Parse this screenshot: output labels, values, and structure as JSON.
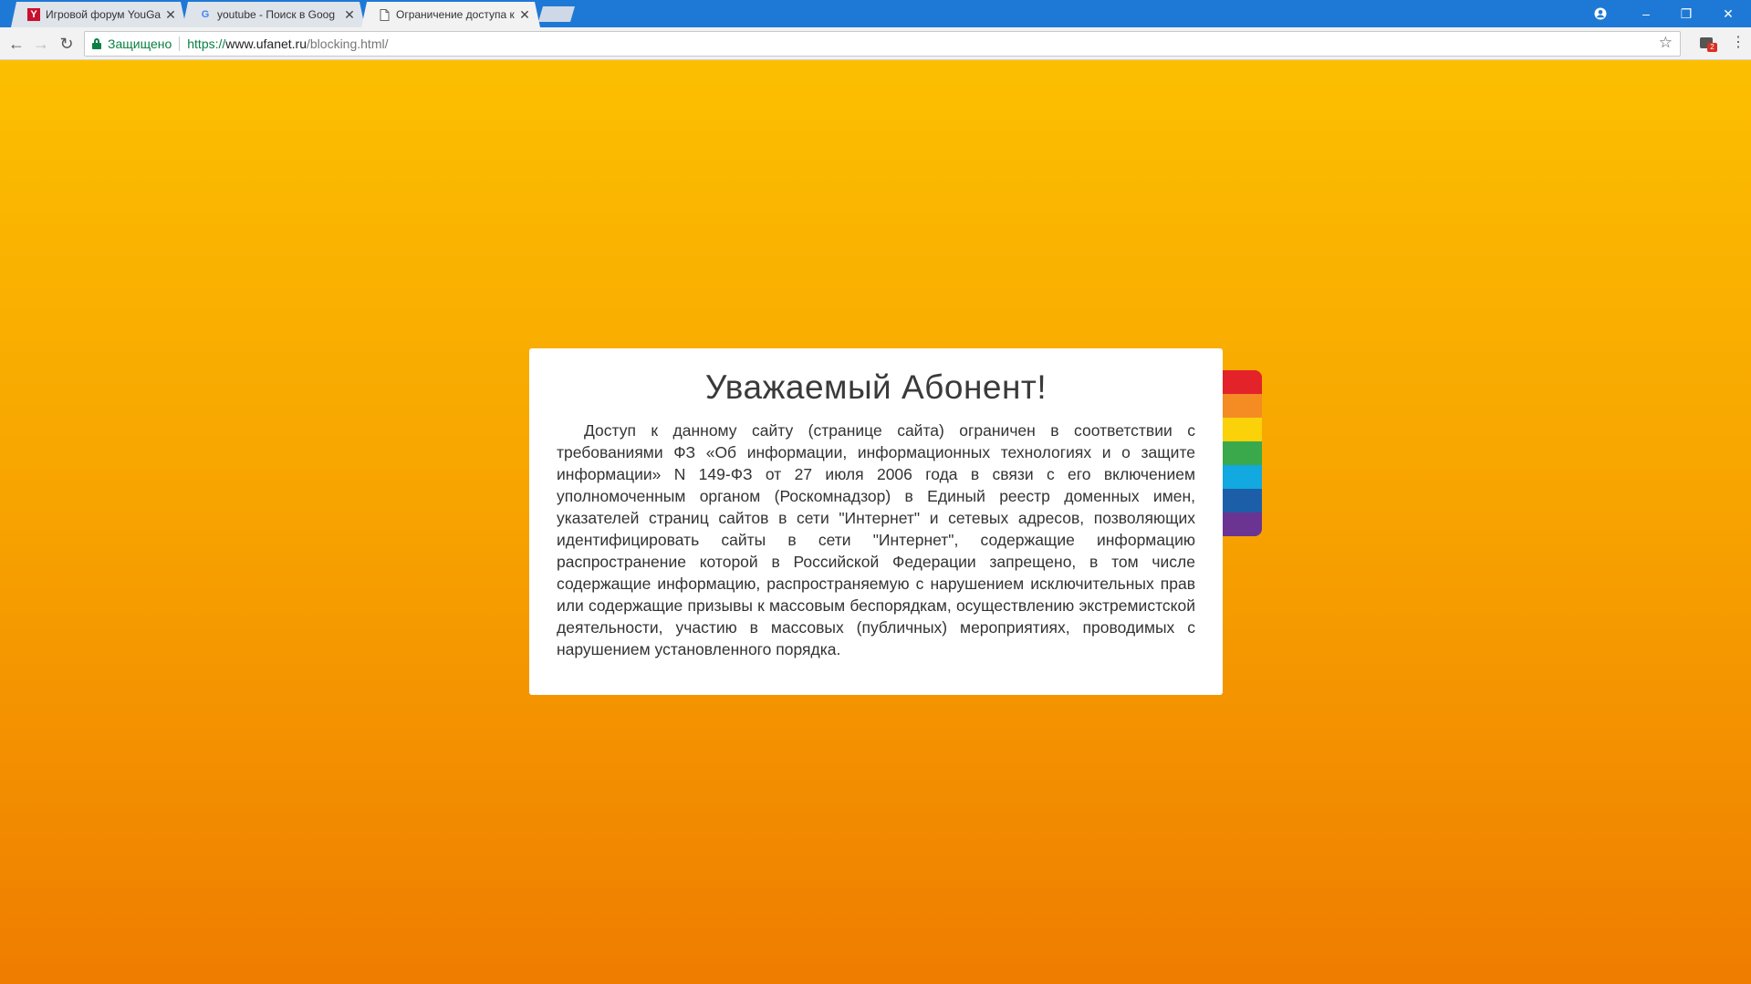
{
  "browser": {
    "tabs": [
      {
        "title": "Игровой форум YouGam",
        "favicon": "Y",
        "favicon_color": "#c8102e",
        "state": "inactive"
      },
      {
        "title": "youtube - Поиск в Goog",
        "favicon": "G",
        "favicon_color": "#4285f4",
        "state": "inactive"
      },
      {
        "title": "Ограничение доступа к",
        "favicon": "page-icon",
        "state": "active"
      }
    ],
    "window_controls": {
      "account": "account-icon",
      "minimize": "–",
      "restore": "❐",
      "close": "✕"
    },
    "toolbar": {
      "back": "←",
      "forward": "→",
      "reload": "↻",
      "secure_label": "Защищено",
      "url_prefix": "https://",
      "url_host": "www.ufanet.ru",
      "url_path": "/blocking.html/",
      "star": "☆",
      "extension_badge": "2",
      "menu": "⋮"
    }
  },
  "colors": {
    "titlebar": "#1e79d6",
    "page_gradient_top": "#fcbf00",
    "page_gradient_bottom": "#ef7d00",
    "secure_green": "#0b8043"
  },
  "notice": {
    "title": "Уважаемый Абонент!",
    "body": "Доступ к данному сайту (странице сайта) ограничен в соответствии с требованиями ФЗ «Об информации, информационных технологиях и о защите информации» N 149-ФЗ от 27 июля 2006 года в связи с его включением уполномоченным органом (Роскомнадзор) в Единый реестр доменных имен, указателей страниц сайтов в сети \"Интернет\" и сетевых адресов, позволяющих идентифицировать сайты в сети \"Интернет\", содержащие информацию распространение которой в Российской Федерации запрещено, в том числе содержащие информацию, распространяемую с нарушением исключительных прав или содержащие призывы к массовым беспорядкам, осуществлению экстремистской деятельности, участию в массовых (публичных) мероприятиях, проводимых с нарушением установленного порядка."
  },
  "stripe_colors": [
    "#e3222a",
    "#f48b23",
    "#fbd10a",
    "#3aa94c",
    "#12a8e0",
    "#1c5fa8",
    "#6b3493"
  ]
}
